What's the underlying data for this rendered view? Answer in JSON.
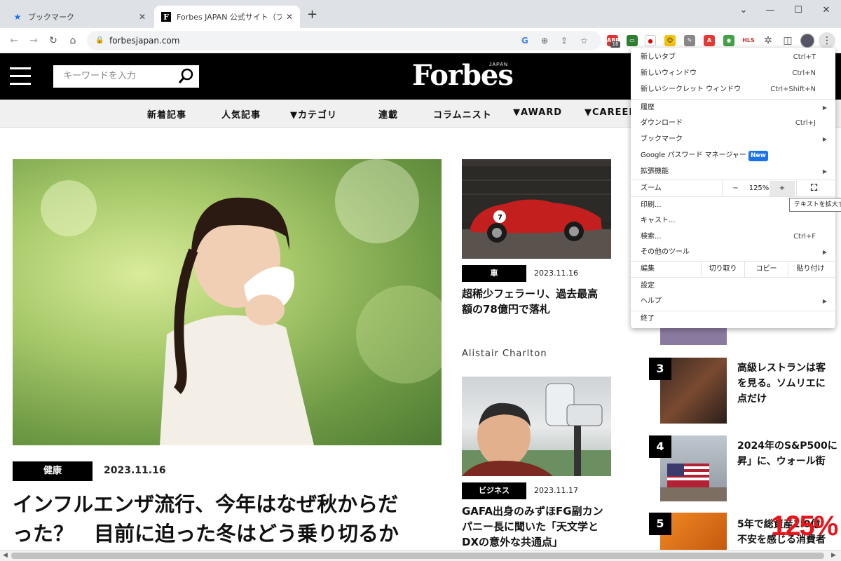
{
  "browser": {
    "tabs": [
      {
        "title": "ブックマーク",
        "icon": "star-icon"
      },
      {
        "title": "Forbes JAPAN 公式サイト（フォーブス",
        "icon": "forbes-f-icon"
      }
    ],
    "new_tab_symbol": "+",
    "window_controls": {
      "minimize": "—",
      "maximize": "☐",
      "close": "✕"
    },
    "url": "forbesjapan.com",
    "extension_badge": "16"
  },
  "site": {
    "search_placeholder": "キーワードを入力",
    "logo": "Forbes",
    "logo_sub": "JAPAN",
    "nav": [
      "新着記事",
      "人気記事",
      "▼カテゴリ",
      "連載",
      "コラムニスト",
      "▼AWARD",
      "▼CAREER"
    ],
    "hero": {
      "category": "健康",
      "date": "2023.11.16",
      "title_line1": "インフルエンザ流行、今年はなぜ秋からだ",
      "title_line2": "った？　目前に迫った冬はどう乗り切るか"
    },
    "side1": {
      "category": "車",
      "date": "2023.11.16",
      "title_line1": "超稀少フェラーリ、過去最高",
      "title_line2": "額の78億円で落札"
    },
    "author": "Alistair Charlton",
    "side2": {
      "category": "ビジネス",
      "date": "2023.11.17",
      "title_line1": "GAFA出身のみずほFG副カン",
      "title_line2": "パニー長に聞いた「天文学と",
      "title_line3": "DXの意外な共通点」"
    },
    "ranking": [
      {
        "num": "3",
        "line1": "高級レストランは客",
        "line2": "を見る。ソムリエに",
        "line3": "点だけ"
      },
      {
        "num": "4",
        "line1": "2024年のS&P500に",
        "line2": "昇」に、ウォール街",
        "line3": ""
      },
      {
        "num": "5",
        "line1": "5年で総資産1.0億",
        "line2": "不安を感じる消費者",
        "line3": ""
      }
    ]
  },
  "menu": {
    "new_tab": "新しいタブ",
    "new_tab_sc": "Ctrl+T",
    "new_window": "新しいウィンドウ",
    "new_window_sc": "Ctrl+N",
    "incognito": "新しいシークレット ウィンドウ",
    "incognito_sc": "Ctrl+Shift+N",
    "history": "履歴",
    "downloads": "ダウンロード",
    "downloads_sc": "Ctrl+J",
    "bookmarks": "ブックマーク",
    "password_manager": "Google パスワード マネージャー",
    "new_badge": "New",
    "extensions": "拡張機能",
    "zoom": "ズーム",
    "zoom_minus": "−",
    "zoom_value": "125%",
    "zoom_plus": "+",
    "print": "印刷...",
    "cast": "キャスト...",
    "find": "検索...",
    "find_sc": "Ctrl+F",
    "more_tools": "その他のツール",
    "edit": "編集",
    "cut": "切り取り",
    "copy": "コピー",
    "paste": "貼り付け",
    "settings": "設定",
    "help": "ヘルプ",
    "exit": "終了",
    "tooltip": "テキストを拡大す"
  },
  "overlay_zoom": "125%"
}
